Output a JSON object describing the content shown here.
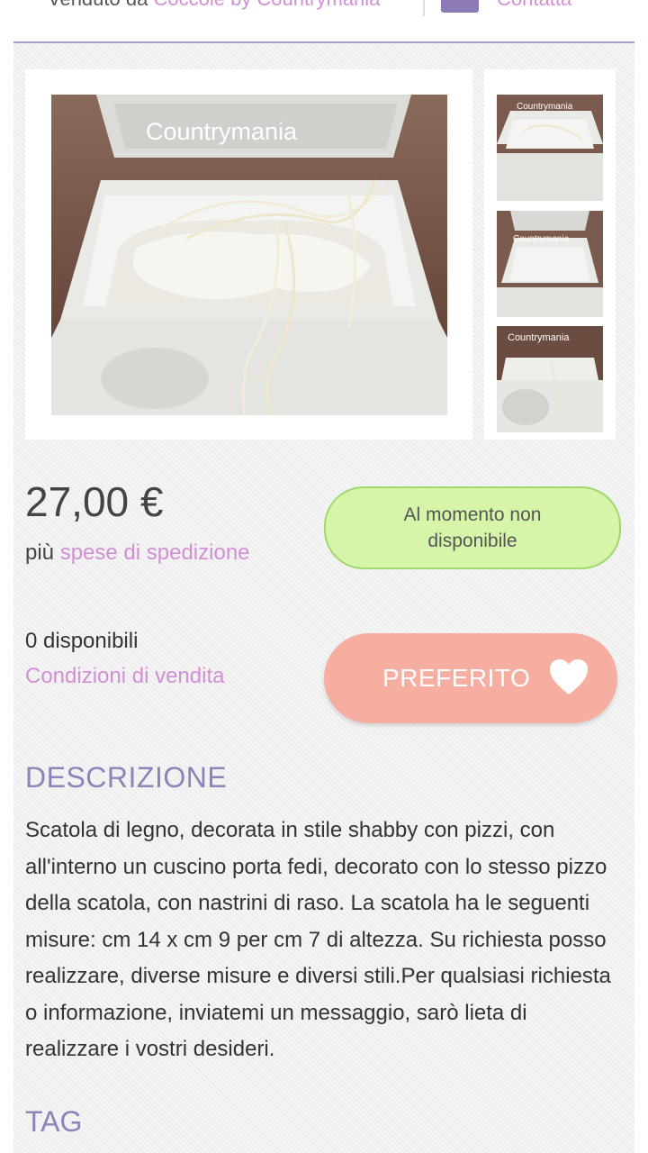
{
  "header": {
    "sold_by_prefix": "Venduto da",
    "shop_name": "Coccole by Countrymania",
    "contact_label": "Contatta",
    "mail_icon": "envelope-icon"
  },
  "gallery": {
    "watermark": "Countrymania",
    "thumb_1_watermark": "Countrymania",
    "thumb_2_watermark": "Countrymania",
    "thumb_3_watermark": "Countrymania"
  },
  "product": {
    "price": "27,00 €",
    "shipping_prefix": "più",
    "shipping_link": "spese di spedizione",
    "availability_button": "Al momento non disponibile",
    "quantity": "0 disponibili",
    "terms_link": "Condizioni di vendita",
    "favorite_button": "PREFERITO",
    "favorite_icon": "heart-icon"
  },
  "description": {
    "title": "DESCRIZIONE",
    "text": "Scatola di legno, decorata in stile shabby con pizzi, con all'interno un cuscino porta fedi, decorato con lo stesso pizzo della scatola, con nastrini di raso. La scatola ha le seguenti misure: cm 14 x cm 9 per cm 7 di altezza. Su richiesta posso realizzare, diverse misure e diversi stili.Per qualsiasi richiesta o informazione, inviatemi un messaggio, sarò lieta di realizzare i vostri desideri."
  },
  "tags": {
    "title": "TAG"
  },
  "colors": {
    "accent_purple": "#8e83b8",
    "link_pink": "#d38fd6",
    "unavailable_green": "#d6f5a8",
    "favorite_salmon": "#f5aea0"
  }
}
